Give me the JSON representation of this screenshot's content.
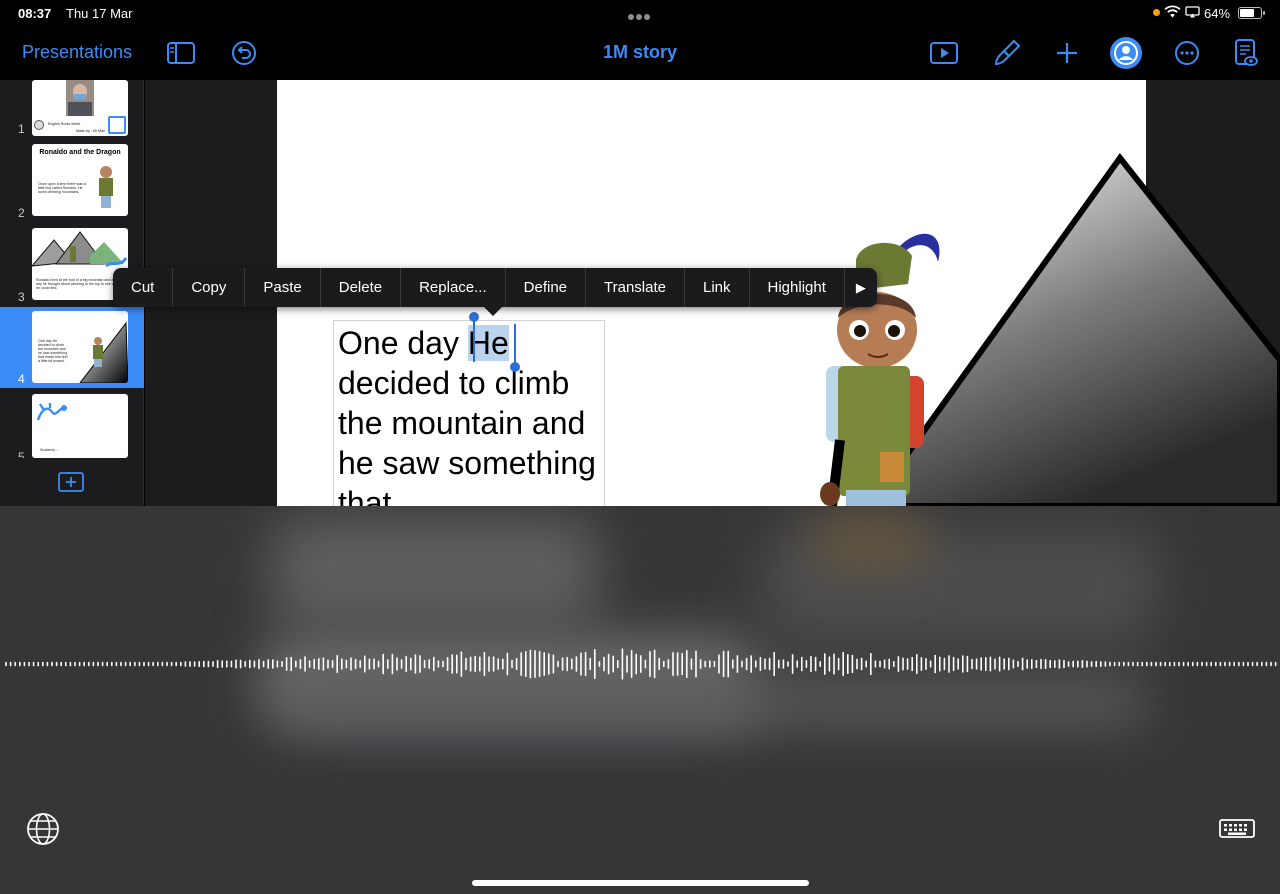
{
  "status_bar": {
    "time": "08:37",
    "date": "Thu 17 Mar",
    "battery": "64%"
  },
  "toolbar": {
    "back_label": "Presentations",
    "document_title": "1M story",
    "icons": [
      "sidebar-icon",
      "undo-icon",
      "play-icon",
      "format-brush-icon",
      "add-icon",
      "collaborate-icon",
      "more-icon",
      "presenter-notes-icon"
    ]
  },
  "slides": [
    {
      "number": "1",
      "footer": "Made by - Mr Mac",
      "subtitle": "English Roots Week"
    },
    {
      "number": "2",
      "title": "Ronaldo and the Dragon",
      "text": "Once upon a time there was a little boy called Ronaldo. He loved climbing mountains."
    },
    {
      "number": "3",
      "text": "Ronaldo lived at the foot of a big mountain and every day he thought about climbing to the top to see what he could find."
    },
    {
      "number": "4",
      "text": "One day He decided to climb the mountain and he saw something that made him feel a little bit scared."
    },
    {
      "number": "5",
      "text": "Suddenly ..."
    }
  ],
  "current_slide": {
    "text_before": "One day ",
    "selected_word": "He",
    "text_after": " decided to climb the mountain and he saw something that"
  },
  "edit_menu": {
    "items": [
      "Cut",
      "Copy",
      "Paste",
      "Delete",
      "Replace...",
      "Define",
      "Translate",
      "Link",
      "Highlight"
    ],
    "more_arrow": "▶"
  },
  "colors": {
    "accent": "#3b8cf6",
    "selection": "#bcd3ee",
    "handle": "#2b6fd6"
  }
}
